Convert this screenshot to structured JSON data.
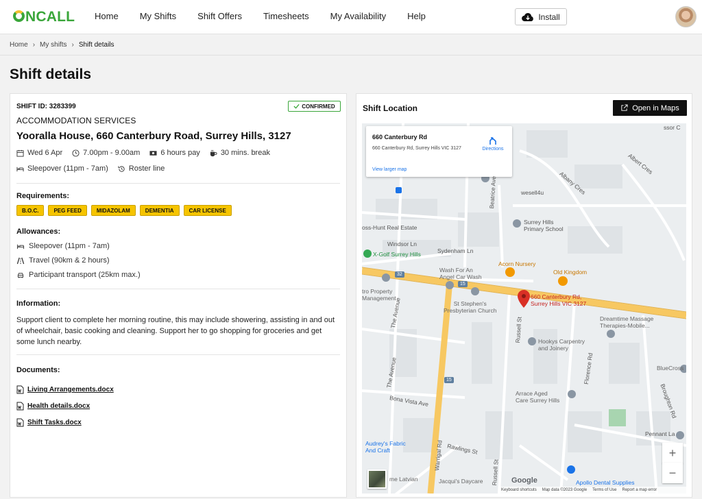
{
  "header": {
    "logo": "ONCALL",
    "nav": [
      "Home",
      "My Shifts",
      "Shift Offers",
      "Timesheets",
      "My Availability",
      "Help"
    ],
    "install_label": "Install"
  },
  "breadcrumb": [
    "Home",
    "My shifts",
    "Shift details"
  ],
  "page_title": "Shift details",
  "shift": {
    "id_label": "SHIFT ID: 3283399",
    "status": "CONFIRMED",
    "service": "ACCOMMODATION SERVICES",
    "address": "Yooralla House, 660 Canterbury Road, Surrey Hills, 3127",
    "date": "Wed 6 Apr",
    "time": "7.00pm - 9.00am",
    "pay": "6 hours pay",
    "break": "30 mins. break",
    "sleepover": "Sleepover (11pm - 7am)",
    "roster": "Roster line"
  },
  "requirements": {
    "title": "Requirements:",
    "tags": [
      "B.O.C.",
      "PEG FEED",
      "MIDAZOLAM",
      "DEMENTIA",
      "CAR LICENSE"
    ]
  },
  "allowances": {
    "title": "Allowances:",
    "items": [
      "Sleepover (11pm - 7am)",
      "Travel (90km & 2 hours)",
      "Participant transport (25km max.)"
    ]
  },
  "information": {
    "title": "Information:",
    "text": "Support client to complete her morning routine, this may include showering, assisting in and out of wheelchair, basic cooking and cleaning. Support her to go shopping for groceries and get some lunch nearby."
  },
  "documents": {
    "title": "Documents:",
    "files": [
      "Living Arrangements.docx",
      "Health details.docx",
      "Shift Tasks.docx"
    ]
  },
  "location": {
    "title": "Shift Location",
    "open_maps_label": "Open in Maps",
    "infobox": {
      "title": "660 Canterbury Rd",
      "address": "660 Canterbury Rd, Surrey Hills VIC 3127",
      "directions": "Directions",
      "larger_map": "View larger map"
    },
    "labels": {
      "albert_cres": "Albert Cres",
      "wesell": "wesell4u",
      "albany_cres": "Albany Cres",
      "beatrice": "Beatrice Ave",
      "school": "Surrey Hills\nPrimary School",
      "real_estate": "oss-Hunt Real Estate",
      "windsor": "Windsor Ln",
      "sydenham": "Sydenham Ln",
      "golf": "X-Golf Surrey Hills",
      "car_wash": "Wash For An\nAngel Car Wash",
      "nursery": "Acorn Nursery",
      "old_kingdom": "Old Kingdom",
      "property": "tro Property\nManagement",
      "church": "St Stephen's\nPresbyterian Church",
      "pin": "660 Canterbury Rd,\nSurrey Hills VIC 3127",
      "massage": "Dreamtime Massage\nTherapies-Mobile...",
      "the_avenue_1": "The Avenue",
      "hookys": "Hookys Carpentry\nand Joinery",
      "russell": "Russell St",
      "florence": "Florence Rd",
      "bluecross": "BlueCross",
      "the_avenue_2": "The Avenue",
      "bona_vista": "Bona Vista Ave",
      "aged_care": "Arrace Aged\nCare Surrey Hills",
      "broughton": "Broughton Rd",
      "warrigal": "Warrigal Rd",
      "pennant": "Pennant La",
      "fabric": "Audrey's Fabric\nAnd Craft",
      "rawlings": "Rawlings St",
      "latvian": "me Latvian",
      "daycare": "Jacqui's Daycare",
      "russell2": "Russell St",
      "dental": "Apollo Dental Supplies",
      "route32": "32",
      "route15a": "15",
      "route15b": "15",
      "roslyn": "ssor C"
    },
    "attribution": {
      "google": "Google",
      "shortcuts": "Keyboard shortcuts",
      "mapdata": "Map data ©2023 Google",
      "terms": "Terms of Use",
      "report": "Report a map error"
    },
    "zoom_in": "+",
    "zoom_out": "−"
  },
  "colors": {
    "brand_green": "#3aa63a",
    "tag_yellow": "#f6c400",
    "major_road": "#f7c862",
    "pin_red": "#d93025"
  }
}
